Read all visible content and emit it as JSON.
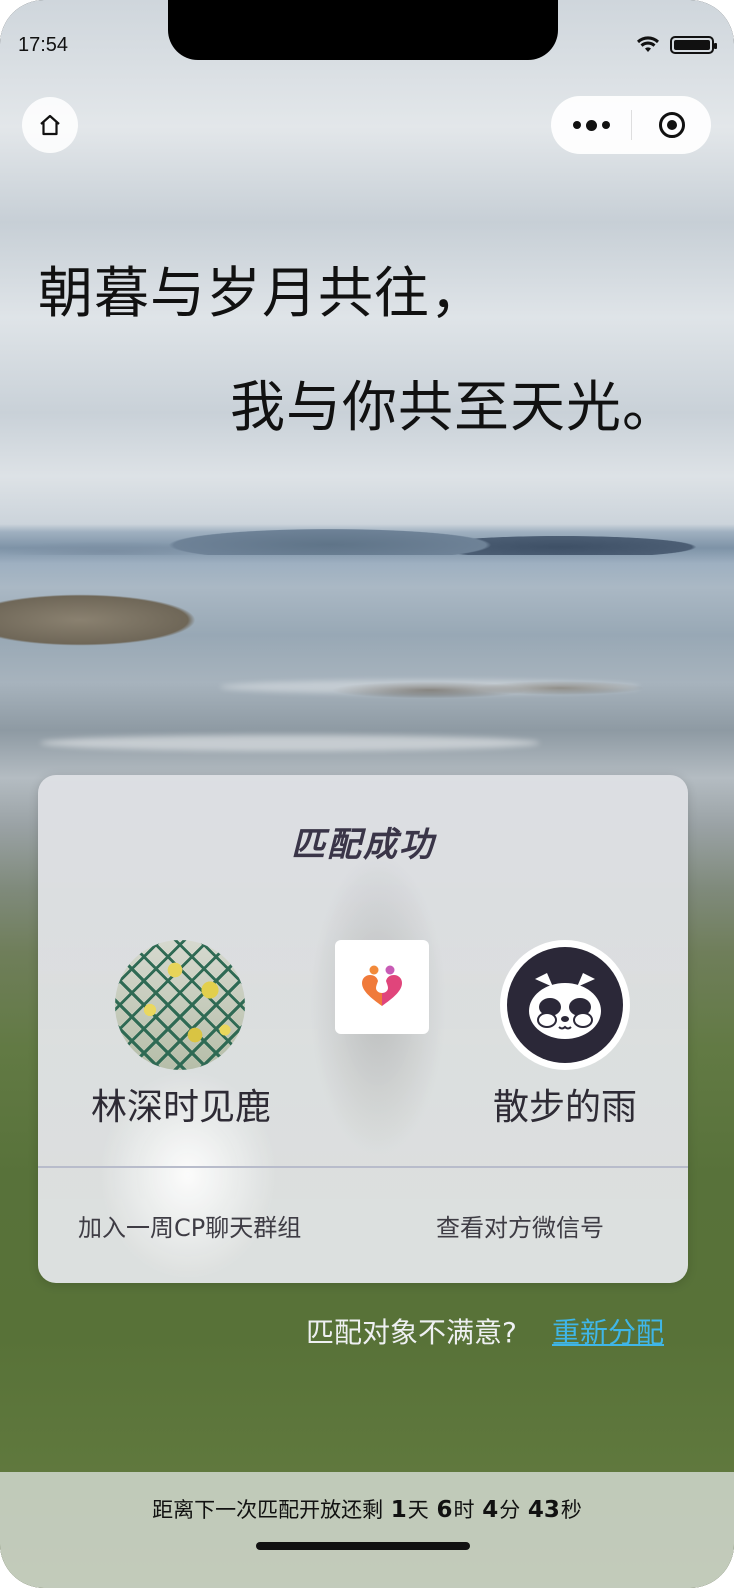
{
  "status_bar": {
    "time": "17:54",
    "wifi_icon": "wifi-icon",
    "battery_icon": "battery-icon"
  },
  "nav": {
    "home_icon": "home-icon",
    "more_icon": "more-dots-icon",
    "close_icon": "target-circle-icon"
  },
  "poem": {
    "line1": "朝暮与岁月共往，",
    "line2": "我与你共至天光。"
  },
  "card": {
    "title": "匹配成功",
    "left_user": {
      "name": "林深时见鹿"
    },
    "right_user": {
      "name": "散步的雨"
    },
    "center_logo_icon": "couple-heart-logo-icon",
    "actions": {
      "join_group": "加入一周CP聊天群组",
      "view_wechat": "查看对方微信号"
    }
  },
  "reassign": {
    "question": "匹配对象不满意?",
    "link": "重新分配"
  },
  "countdown": {
    "prefix": "距离下一次匹配开放还剩",
    "days": "1",
    "days_unit": "天",
    "hours": "6",
    "hours_unit": "时",
    "minutes": "4",
    "minutes_unit": "分",
    "seconds": "43",
    "seconds_unit": "秒"
  },
  "colors": {
    "link": "#3fb6e8",
    "title": "#3a3548",
    "logo_orange": "#f28a3a",
    "logo_pink": "#e0457b",
    "logo_purple": "#9b5bd6"
  }
}
